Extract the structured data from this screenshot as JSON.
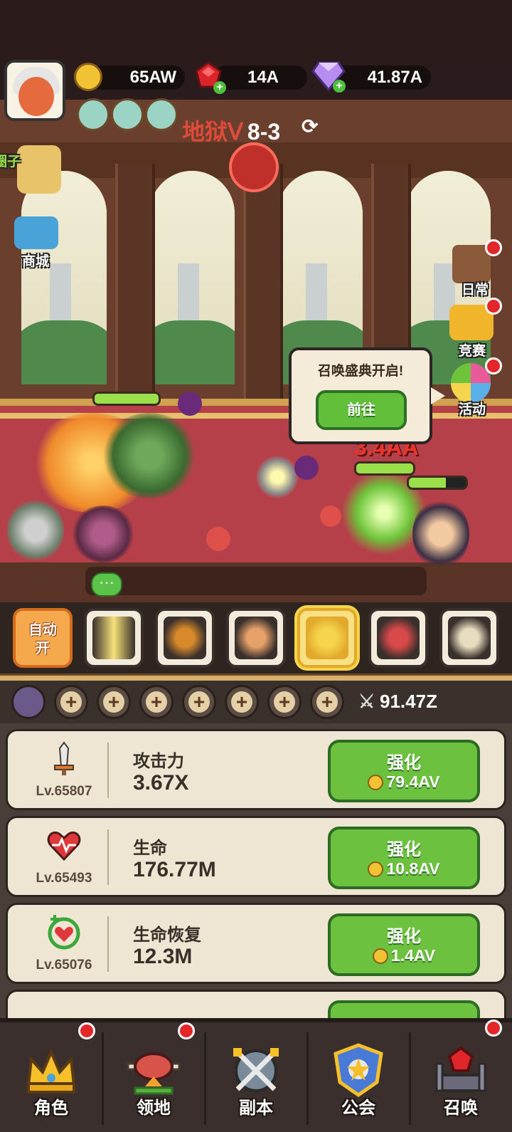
{
  "hud": {
    "gold": "65AW",
    "ruby": "14A",
    "diamond": "41.87A",
    "stage_mode": "地狱Ⅴ",
    "stage_level": "8-3"
  },
  "side_left": [
    {
      "label": "圈子"
    },
    {
      "label": "商城"
    }
  ],
  "side_right": [
    {
      "label": "日常"
    },
    {
      "label": "竞赛"
    },
    {
      "label": "活动"
    }
  ],
  "battle": {
    "damage_text": "3.4AA"
  },
  "popup": {
    "title": "召唤盛典开启!",
    "button": "前往"
  },
  "skills": {
    "auto_label_1": "自动",
    "auto_label_2": "开"
  },
  "team": {
    "power": "91.47Z"
  },
  "upgrades": [
    {
      "icon": "sword-icon",
      "level": "Lv.65807",
      "name": "攻击力",
      "value": "3.67X",
      "button": "强化",
      "cost": "79.4AV"
    },
    {
      "icon": "heart-icon",
      "level": "Lv.65493",
      "name": "生命",
      "value": "176.77M",
      "button": "强化",
      "cost": "10.8AV"
    },
    {
      "icon": "heart-regen-icon",
      "level": "Lv.65076",
      "name": "生命恢复",
      "value": "12.3M",
      "button": "强化",
      "cost": "1.4AV"
    }
  ],
  "nav": [
    {
      "label": "角色",
      "icon": "crown-icon"
    },
    {
      "label": "领地",
      "icon": "meat-icon"
    },
    {
      "label": "副本",
      "icon": "swords-icon"
    },
    {
      "label": "公会",
      "icon": "guild-shield-icon"
    },
    {
      "label": "召唤",
      "icon": "summon-gem-icon"
    }
  ],
  "colors": {
    "accent_green": "#6cc13e",
    "alert_red": "#e3262a",
    "stage_red": "#e04a3a"
  }
}
